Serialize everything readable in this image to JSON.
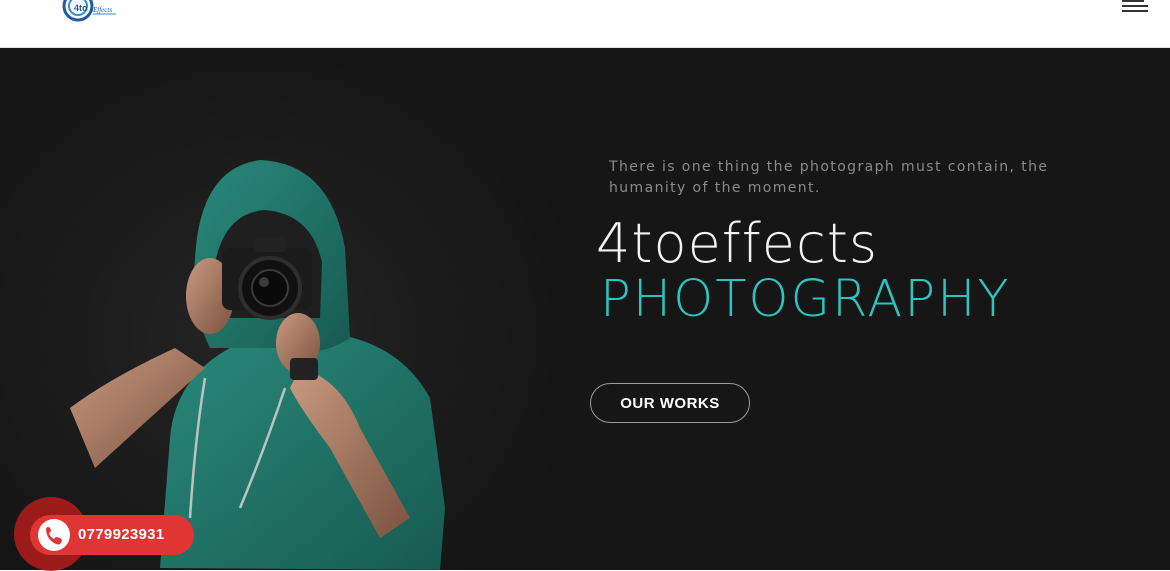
{
  "header": {
    "logo": {
      "text": "4to",
      "tagline": "Effects",
      "icon": "camera-lens-logo"
    },
    "menu_icon": "hamburger-menu-icon"
  },
  "hero": {
    "photo_description_icon": "photographer-image",
    "quote": "There is one thing the photograph must contain, the humanity of the moment.",
    "brand": "4toeffects",
    "subtitle": "PHOTOGRAPHY",
    "cta_label": "OUR WORKS"
  },
  "call_widget": {
    "phone_number": "0779923931",
    "icon": "phone-icon"
  },
  "colors": {
    "accent": "#2cc4be",
    "hero_bg": "#161616",
    "call_red": "#e03535"
  }
}
